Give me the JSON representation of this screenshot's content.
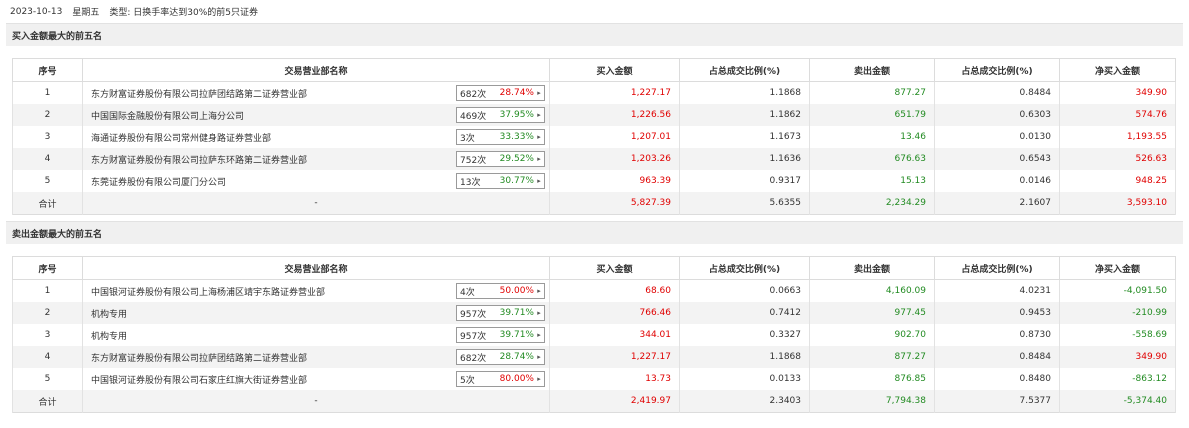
{
  "header": {
    "date": "2023-10-13",
    "weekday": "星期五",
    "type_label": "类型:",
    "type_value": "日换手率达到30%的前5只证券"
  },
  "colors": {
    "up": "#e00000",
    "down": "#228b22",
    "stripe": "#f3f3f3"
  },
  "columns": [
    "序号",
    "交易营业部名称",
    "买入金额",
    "占总成交比例(%)",
    "卖出金额",
    "占总成交比例(%)",
    "净买入金额"
  ],
  "buy_section": {
    "title": "买入金额最大的前五名",
    "rows": [
      {
        "idx": "1",
        "name": "东方财富证券股份有限公司拉萨团结路第二证券营业部",
        "count": "682次",
        "pct": "28.74%",
        "pct_color": "red",
        "buy": "1,227.17",
        "buy_ratio": "1.1868",
        "sell": "877.27",
        "sell_ratio": "0.8484",
        "net": "349.90",
        "net_color": "red"
      },
      {
        "idx": "2",
        "name": "中国国际金融股份有限公司上海分公司",
        "count": "469次",
        "pct": "37.95%",
        "pct_color": "green",
        "buy": "1,226.56",
        "buy_ratio": "1.1862",
        "sell": "651.79",
        "sell_ratio": "0.6303",
        "net": "574.76",
        "net_color": "red"
      },
      {
        "idx": "3",
        "name": "海通证券股份有限公司常州健身路证券营业部",
        "count": "3次",
        "pct": "33.33%",
        "pct_color": "green",
        "buy": "1,207.01",
        "buy_ratio": "1.1673",
        "sell": "13.46",
        "sell_ratio": "0.0130",
        "net": "1,193.55",
        "net_color": "red"
      },
      {
        "idx": "4",
        "name": "东方财富证券股份有限公司拉萨东环路第二证券营业部",
        "count": "752次",
        "pct": "29.52%",
        "pct_color": "green",
        "buy": "1,203.26",
        "buy_ratio": "1.1636",
        "sell": "676.63",
        "sell_ratio": "0.6543",
        "net": "526.63",
        "net_color": "red"
      },
      {
        "idx": "5",
        "name": "东莞证券股份有限公司厦门分公司",
        "count": "13次",
        "pct": "30.77%",
        "pct_color": "green",
        "buy": "963.39",
        "buy_ratio": "0.9317",
        "sell": "15.13",
        "sell_ratio": "0.0146",
        "net": "948.25",
        "net_color": "red"
      }
    ],
    "total": {
      "label": "合计",
      "name": "-",
      "buy": "5,827.39",
      "buy_ratio": "5.6355",
      "sell": "2,234.29",
      "sell_ratio": "2.1607",
      "net": "3,593.10",
      "net_color": "red"
    }
  },
  "sell_section": {
    "title": "卖出金额最大的前五名",
    "rows": [
      {
        "idx": "1",
        "name": "中国银河证券股份有限公司上海杨浦区靖宇东路证券营业部",
        "count": "4次",
        "pct": "50.00%",
        "pct_color": "red",
        "buy": "68.60",
        "buy_ratio": "0.0663",
        "sell": "4,160.09",
        "sell_ratio": "4.0231",
        "net": "-4,091.50",
        "net_color": "green"
      },
      {
        "idx": "2",
        "name": "机构专用",
        "count": "957次",
        "pct": "39.71%",
        "pct_color": "green",
        "buy": "766.46",
        "buy_ratio": "0.7412",
        "sell": "977.45",
        "sell_ratio": "0.9453",
        "net": "-210.99",
        "net_color": "green"
      },
      {
        "idx": "3",
        "name": "机构专用",
        "count": "957次",
        "pct": "39.71%",
        "pct_color": "green",
        "buy": "344.01",
        "buy_ratio": "0.3327",
        "sell": "902.70",
        "sell_ratio": "0.8730",
        "net": "-558.69",
        "net_color": "green"
      },
      {
        "idx": "4",
        "name": "东方财富证券股份有限公司拉萨团结路第二证券营业部",
        "count": "682次",
        "pct": "28.74%",
        "pct_color": "green",
        "buy": "1,227.17",
        "buy_ratio": "1.1868",
        "sell": "877.27",
        "sell_ratio": "0.8484",
        "net": "349.90",
        "net_color": "red"
      },
      {
        "idx": "5",
        "name": "中国银河证券股份有限公司石家庄红旗大街证券营业部",
        "count": "5次",
        "pct": "80.00%",
        "pct_color": "red",
        "buy": "13.73",
        "buy_ratio": "0.0133",
        "sell": "876.85",
        "sell_ratio": "0.8480",
        "net": "-863.12",
        "net_color": "green"
      }
    ],
    "total": {
      "label": "合计",
      "name": "-",
      "buy": "2,419.97",
      "buy_ratio": "2.3403",
      "sell": "7,794.38",
      "sell_ratio": "7.5377",
      "net": "-5,374.40",
      "net_color": "green"
    }
  }
}
